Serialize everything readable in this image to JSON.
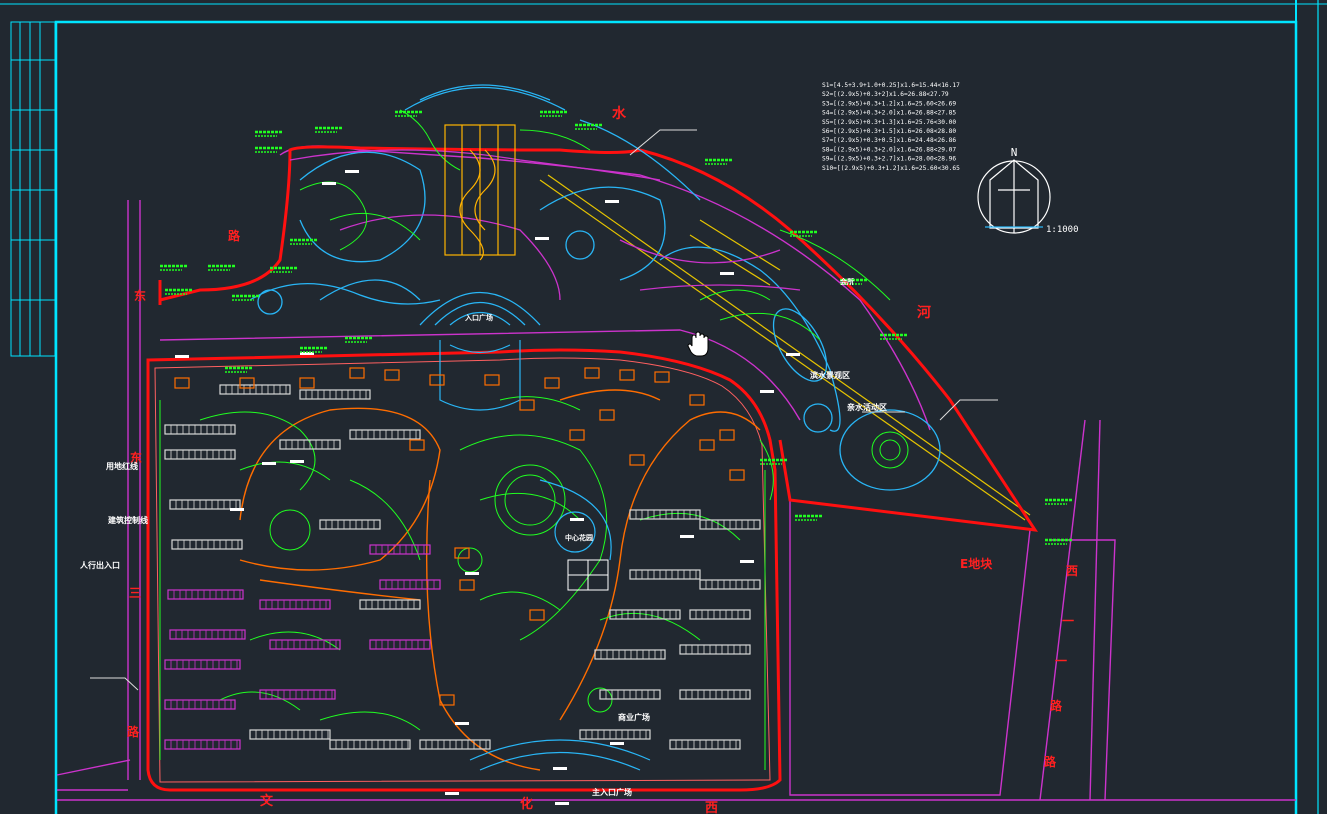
{
  "app": {
    "viewport": "CAD model space",
    "colors": {
      "background": "#212830",
      "frame": "#00e5ff",
      "boundary": "#ff1010",
      "road": "#cc33cc",
      "vegetation": "#21ff21",
      "water": "#29b6f6",
      "rail": "#e6c400",
      "building_fill": "#cc33cc",
      "text": "#ffffff",
      "label_red": "#ff2020"
    }
  },
  "formulas": [
    "S1=[4.5+3.9+1.0+0.25]x1.6=15.44<16.17",
    "S2=[(2.9x5)+0.3+2]x1.6=26.88<27.79",
    "S3=[(2.9x5)+0.3+1.2]x1.6=25.60<26.69",
    "S4=[(2.9x5)+0.3+2.0]x1.6=26.88<27.85",
    "S5=[(2.9x5)+0.3+1.3]x1.6=25.76<30.00",
    "S6=[(2.9x5)+0.3+1.5]x1.6=26.08<28.80",
    "S7=[(2.9x5)+0.3+0.5]x1.6=24.48<26.86",
    "S8=[(2.9x5)+0.3+2.0]x1.6=26.88<29.07",
    "S9=[(2.9x5)+0.3+2.7]x1.6=28.00<28.96",
    "S10=[(2.9x5)+0.3+1.2]x1.6=25.60<30.65"
  ],
  "north_arrow": {
    "label": "N",
    "scale": "1:1000",
    "icon": "north-arrow-icon"
  },
  "river_chars": [
    "水",
    "河"
  ],
  "west_road_chars": [
    "东",
    "三"
  ],
  "east_road_chars": [
    "西",
    "一",
    "路"
  ],
  "south_road_chars": [
    "文",
    "化",
    "西"
  ],
  "misc_red_labels": [
    "路"
  ],
  "plot_label": "E地块",
  "left_labels": {
    "boundary_line": "用地红线",
    "setback_line": "建筑控制线",
    "entrance": "人行出入口"
  },
  "site_labels": {
    "north_plaza": "入口广场",
    "central_garden": "中心花园",
    "park_area_1": "滨水景观区",
    "park_area_2": "亲水活动区",
    "main_gate": "主入口广场",
    "south_square": "商业广场",
    "clubhouse": "会所"
  },
  "cursor": {
    "icon": "hand-pan-cursor-icon"
  }
}
